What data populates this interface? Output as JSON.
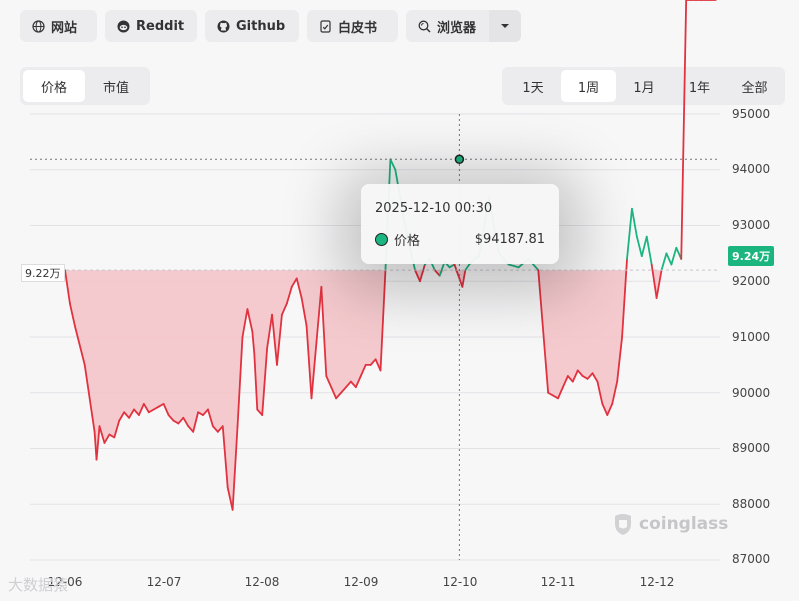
{
  "toolbar": {
    "website": "网站",
    "reddit": "Reddit",
    "github": "Github",
    "whitepaper": "白皮书",
    "browser": "浏览器"
  },
  "metric_tabs": [
    "价格",
    "市值"
  ],
  "metric_active": "价格",
  "range_tabs": [
    "1天",
    "1周",
    "1月",
    "1年",
    "全部"
  ],
  "range_active": "1周",
  "tooltip": {
    "datetime": "2025-12-10 00:30",
    "series": "价格",
    "value": "$94187.81"
  },
  "current_price_label": "9.24万",
  "reference_price_label": "9.22万",
  "watermark": "coinglass",
  "footer_watermark": "大数据猿",
  "colors": {
    "up": "#1bb580",
    "down": "#e0323f",
    "down_fill": "#f4c2c7"
  },
  "chart_data": {
    "type": "area",
    "y_ticks": [
      "95000",
      "94000",
      "93000",
      "92000",
      "91000",
      "90000",
      "89000",
      "88000",
      "87000"
    ],
    "x_ticks": [
      "12-06",
      "12-07",
      "12-08",
      "12-09",
      "12-10",
      "12-11",
      "12-12"
    ],
    "ylim": [
      87000,
      95000
    ],
    "baseline": 92200,
    "highlight": {
      "x": 4.0,
      "y": 94187.81
    },
    "x": [
      0.0,
      0.05,
      0.1,
      0.2,
      0.3,
      0.32,
      0.35,
      0.4,
      0.45,
      0.5,
      0.55,
      0.6,
      0.65,
      0.7,
      0.75,
      0.8,
      0.85,
      0.9,
      0.95,
      1.0,
      1.05,
      1.1,
      1.15,
      1.2,
      1.25,
      1.3,
      1.35,
      1.4,
      1.45,
      1.5,
      1.55,
      1.6,
      1.65,
      1.7,
      1.75,
      1.8,
      1.85,
      1.9,
      1.92,
      1.95,
      2.0,
      2.05,
      2.1,
      2.15,
      2.2,
      2.25,
      2.3,
      2.35,
      2.4,
      2.45,
      2.5,
      2.55,
      2.6,
      2.65,
      2.7,
      2.75,
      2.8,
      2.85,
      2.9,
      2.95,
      3.0,
      3.05,
      3.1,
      3.15,
      3.2,
      3.25,
      3.3,
      3.35,
      3.4,
      3.45,
      3.5,
      3.55,
      3.6,
      3.65,
      3.7,
      3.75,
      3.8,
      3.85,
      3.9,
      3.95,
      4.0,
      4.03,
      4.06,
      4.1,
      4.15,
      4.2,
      4.3,
      4.4,
      4.5,
      4.6,
      4.7,
      4.8,
      4.9,
      5.0,
      5.05,
      5.1,
      5.15,
      5.2,
      5.25,
      5.3,
      5.35,
      5.4,
      5.45,
      5.5,
      5.55,
      5.6,
      5.65,
      5.7,
      5.75,
      5.8,
      5.85,
      5.9,
      5.95,
      6.0,
      6.05,
      6.1,
      6.15,
      6.2,
      6.25,
      6.3,
      6.35,
      6.4,
      6.45,
      6.5,
      6.55,
      6.6
    ],
    "y": [
      92200,
      91600,
      91200,
      90500,
      89300,
      88800,
      89400,
      89100,
      89250,
      89200,
      89500,
      89650,
      89550,
      89700,
      89600,
      89800,
      89650,
      89700,
      89750,
      89800,
      89600,
      89500,
      89450,
      89550,
      89400,
      89300,
      89650,
      89600,
      89700,
      89400,
      89300,
      89400,
      88300,
      87900,
      89400,
      91000,
      91500,
      91100,
      90700,
      89700,
      89600,
      90800,
      91400,
      90500,
      91400,
      91600,
      91900,
      92050,
      91700,
      91200,
      89900,
      90900,
      91900,
      90300,
      90100,
      89900,
      90000,
      90100,
      90200,
      90100,
      90300,
      90500,
      90500,
      90600,
      90400,
      92200,
      94187,
      94000,
      93500,
      93000,
      92600,
      92200,
      92000,
      92300,
      92400,
      92200,
      92100,
      92350,
      92250,
      92300,
      92050,
      91900,
      92200,
      92300,
      92400,
      92450,
      93500,
      92500,
      92300,
      92250,
      92400,
      92200,
      90000,
      89900,
      90100,
      90300,
      90200,
      90400,
      90300,
      90250,
      90350,
      90200,
      89800,
      89600,
      89800,
      90200,
      91000,
      92400,
      93300,
      92800,
      92450,
      92800,
      92300,
      91700,
      92200,
      92500,
      92300,
      92600,
      92400
    ]
  }
}
